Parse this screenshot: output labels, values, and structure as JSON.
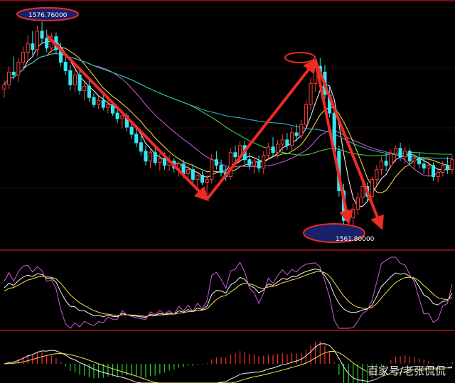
{
  "chart_data": {
    "type": "candlestick",
    "annotations": {
      "high_label": "1576.76000",
      "low_label": "1561.80000"
    },
    "colors": {
      "up": "#ff3b3b",
      "down": "#35e6f0",
      "ma_short": "#f5f5f5",
      "ma_mid": "#f7e04a",
      "ma_long1": "#d35bd8",
      "ma_long2": "#4bd34b",
      "ma_long3": "#2fb6c4",
      "arrow": "#ee2b24",
      "ellipse_fill": "#18226a",
      "ellipse_stroke": "#ee2b24",
      "separator": "#a8141c",
      "macd_up": "#ff2d2d",
      "macd_down": "#2fd12f"
    },
    "price_range": [
      1560.9,
      1577.8
    ],
    "candles": [
      [
        1572.0,
        1572.6,
        1571.4,
        1572.3
      ],
      [
        1572.3,
        1573.6,
        1572.0,
        1573.2
      ],
      [
        1573.2,
        1574.3,
        1572.7,
        1573.0
      ],
      [
        1573.0,
        1574.2,
        1572.5,
        1573.9
      ],
      [
        1573.9,
        1575.0,
        1573.3,
        1574.6
      ],
      [
        1574.6,
        1575.8,
        1574.0,
        1575.2
      ],
      [
        1575.2,
        1576.1,
        1574.4,
        1574.8
      ],
      [
        1574.8,
        1576.5,
        1574.3,
        1576.1
      ],
      [
        1576.1,
        1576.76,
        1575.2,
        1575.6
      ],
      [
        1575.6,
        1576.2,
        1574.6,
        1574.9
      ],
      [
        1574.9,
        1576.0,
        1574.6,
        1575.7
      ],
      [
        1575.7,
        1576.0,
        1574.5,
        1574.8
      ],
      [
        1574.8,
        1575.3,
        1573.6,
        1573.9
      ],
      [
        1573.9,
        1574.4,
        1573.0,
        1573.3
      ],
      [
        1573.3,
        1573.7,
        1571.9,
        1572.3
      ],
      [
        1572.3,
        1573.4,
        1571.8,
        1573.0
      ],
      [
        1573.0,
        1573.3,
        1571.6,
        1571.9
      ],
      [
        1571.9,
        1572.5,
        1571.2,
        1572.2
      ],
      [
        1572.2,
        1572.6,
        1571.1,
        1571.4
      ],
      [
        1571.4,
        1571.7,
        1570.7,
        1570.9
      ],
      [
        1570.9,
        1571.5,
        1570.6,
        1571.2
      ],
      [
        1571.2,
        1571.6,
        1570.5,
        1570.7
      ],
      [
        1570.7,
        1571.2,
        1570.3,
        1570.9
      ],
      [
        1570.9,
        1571.1,
        1570.1,
        1570.3
      ],
      [
        1570.3,
        1570.7,
        1569.6,
        1569.9
      ],
      [
        1569.9,
        1570.4,
        1569.2,
        1570.1
      ],
      [
        1570.1,
        1570.3,
        1569.0,
        1569.3
      ],
      [
        1569.3,
        1569.6,
        1568.5,
        1568.8
      ],
      [
        1568.8,
        1569.2,
        1567.9,
        1568.2
      ],
      [
        1568.2,
        1568.7,
        1567.3,
        1567.6
      ],
      [
        1567.6,
        1568.0,
        1566.6,
        1566.9
      ],
      [
        1566.9,
        1567.8,
        1566.4,
        1567.5
      ],
      [
        1567.5,
        1567.9,
        1566.6,
        1566.8
      ],
      [
        1566.8,
        1567.4,
        1566.2,
        1567.1
      ],
      [
        1567.1,
        1567.5,
        1566.3,
        1566.6
      ],
      [
        1566.6,
        1567.3,
        1566.2,
        1566.9
      ],
      [
        1566.9,
        1567.1,
        1566.1,
        1566.4
      ],
      [
        1566.4,
        1566.9,
        1565.8,
        1566.7
      ],
      [
        1566.7,
        1567.0,
        1565.7,
        1566.0
      ],
      [
        1566.0,
        1566.6,
        1565.6,
        1566.3
      ],
      [
        1566.3,
        1566.7,
        1565.3,
        1565.6
      ],
      [
        1565.6,
        1566.1,
        1565.0,
        1565.9
      ],
      [
        1565.9,
        1566.2,
        1565.2,
        1565.4
      ],
      [
        1565.4,
        1565.9,
        1564.5,
        1565.6
      ],
      [
        1565.6,
        1567.4,
        1565.3,
        1567.0
      ],
      [
        1567.0,
        1567.6,
        1566.3,
        1566.6
      ],
      [
        1566.6,
        1567.0,
        1565.8,
        1566.1
      ],
      [
        1566.1,
        1566.5,
        1565.5,
        1565.8
      ],
      [
        1565.8,
        1567.8,
        1565.6,
        1567.5
      ],
      [
        1567.5,
        1568.0,
        1566.9,
        1567.2
      ],
      [
        1567.2,
        1568.3,
        1566.8,
        1568.0
      ],
      [
        1568.0,
        1568.3,
        1566.7,
        1567.0
      ],
      [
        1567.0,
        1567.5,
        1566.3,
        1566.6
      ],
      [
        1566.6,
        1567.2,
        1566.0,
        1566.9
      ],
      [
        1566.9,
        1567.3,
        1566.1,
        1566.4
      ],
      [
        1566.4,
        1567.6,
        1566.0,
        1567.3
      ],
      [
        1567.3,
        1568.2,
        1567.0,
        1567.9
      ],
      [
        1567.9,
        1568.6,
        1567.2,
        1567.5
      ],
      [
        1567.5,
        1568.4,
        1567.1,
        1568.1
      ],
      [
        1568.1,
        1568.8,
        1567.6,
        1568.4
      ],
      [
        1568.4,
        1568.9,
        1567.7,
        1568.0
      ],
      [
        1568.0,
        1569.3,
        1567.6,
        1568.9
      ],
      [
        1568.9,
        1569.5,
        1568.3,
        1568.7
      ],
      [
        1568.7,
        1569.8,
        1568.5,
        1569.5
      ],
      [
        1569.5,
        1571.2,
        1569.3,
        1570.9
      ],
      [
        1570.9,
        1572.8,
        1570.5,
        1572.4
      ],
      [
        1572.4,
        1574.0,
        1571.8,
        1573.6
      ],
      [
        1573.6,
        1574.2,
        1572.9,
        1573.2
      ],
      [
        1573.2,
        1573.7,
        1571.3,
        1571.6
      ],
      [
        1571.6,
        1572.2,
        1570.0,
        1570.3
      ],
      [
        1570.3,
        1570.6,
        1567.2,
        1567.6
      ],
      [
        1567.6,
        1568.0,
        1564.4,
        1564.8
      ],
      [
        1564.8,
        1565.3,
        1562.3,
        1562.7
      ],
      [
        1562.7,
        1563.5,
        1561.8,
        1562.9
      ],
      [
        1562.9,
        1563.9,
        1562.3,
        1563.5
      ],
      [
        1563.5,
        1564.7,
        1563.1,
        1564.3
      ],
      [
        1564.3,
        1565.6,
        1563.9,
        1565.1
      ],
      [
        1565.1,
        1565.4,
        1564.0,
        1564.4
      ],
      [
        1564.4,
        1565.8,
        1564.2,
        1565.6
      ],
      [
        1565.6,
        1566.6,
        1565.2,
        1566.3
      ],
      [
        1566.3,
        1567.2,
        1565.9,
        1566.9
      ],
      [
        1566.9,
        1567.5,
        1566.2,
        1566.6
      ],
      [
        1566.6,
        1567.7,
        1566.4,
        1567.4
      ],
      [
        1567.4,
        1568.0,
        1566.8,
        1567.8
      ],
      [
        1567.8,
        1568.2,
        1566.9,
        1567.2
      ],
      [
        1567.2,
        1567.9,
        1566.7,
        1567.6
      ],
      [
        1567.6,
        1567.8,
        1566.6,
        1566.9
      ],
      [
        1566.9,
        1567.4,
        1566.3,
        1567.1
      ],
      [
        1567.1,
        1567.5,
        1566.4,
        1566.7
      ],
      [
        1566.7,
        1567.1,
        1566.0,
        1566.4
      ],
      [
        1566.4,
        1566.9,
        1565.8,
        1566.6
      ],
      [
        1566.6,
        1566.8,
        1565.5,
        1565.8
      ],
      [
        1565.8,
        1566.3,
        1565.4,
        1566.1
      ],
      [
        1566.1,
        1566.9,
        1565.8,
        1566.6
      ],
      [
        1566.6,
        1567.2,
        1566.0,
        1566.3
      ],
      [
        1566.3,
        1567.3,
        1566.0,
        1567.0
      ]
    ],
    "ma_periods": [
      5,
      10,
      20,
      40,
      60
    ],
    "arrows": [
      {
        "from": 9,
        "to": 43,
        "from_price": 1575.8,
        "to_price": 1564.2
      },
      {
        "from": 43,
        "to": 66,
        "from_price": 1564.2,
        "to_price": 1574.0
      },
      {
        "from": 66,
        "to": 73,
        "from_price": 1574.0,
        "to_price": 1562.6
      },
      {
        "from": 66,
        "to": 80,
        "from_price": 1574.0,
        "to_price": 1562.2
      }
    ]
  },
  "watermark": "百家号/老张侃侃"
}
